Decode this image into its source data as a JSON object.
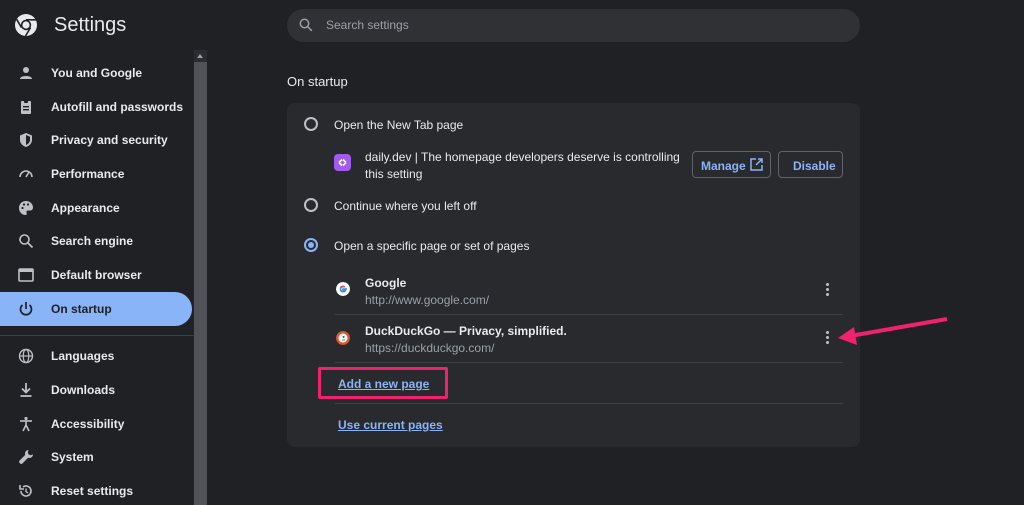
{
  "header": {
    "title": "Settings",
    "search_placeholder": "Search settings"
  },
  "sidebar": {
    "items": [
      {
        "label": "You and Google",
        "icon": "person-icon"
      },
      {
        "label": "Autofill and passwords",
        "icon": "clipboard-icon"
      },
      {
        "label": "Privacy and security",
        "icon": "shield-icon"
      },
      {
        "label": "Performance",
        "icon": "gauge-icon"
      },
      {
        "label": "Appearance",
        "icon": "palette-icon"
      },
      {
        "label": "Search engine",
        "icon": "search-icon"
      },
      {
        "label": "Default browser",
        "icon": "browser-icon"
      },
      {
        "label": "On startup",
        "icon": "power-icon",
        "active": true
      },
      {
        "label": "Languages",
        "icon": "globe-icon"
      },
      {
        "label": "Downloads",
        "icon": "download-icon"
      },
      {
        "label": "Accessibility",
        "icon": "accessibility-icon"
      },
      {
        "label": "System",
        "icon": "wrench-icon"
      },
      {
        "label": "Reset settings",
        "icon": "reset-icon"
      }
    ]
  },
  "main": {
    "section_title": "On startup",
    "options": [
      {
        "label": "Open the New Tab page",
        "selected": false
      },
      {
        "label": "Continue where you left off",
        "selected": false
      },
      {
        "label": "Open a specific page or set of pages",
        "selected": true
      }
    ],
    "extension": {
      "text": "daily.dev | The homepage developers deserve is controlling this setting",
      "manage_label": "Manage",
      "disable_label": "Disable"
    },
    "pages": [
      {
        "title": "Google",
        "url": "http://www.google.com/",
        "icon": "google-favicon"
      },
      {
        "title": "DuckDuckGo — Privacy, simplified.",
        "url": "https://duckduckgo.com/",
        "icon": "duckduckgo-favicon"
      }
    ],
    "add_page_label": "Add a new page",
    "use_current_label": "Use current pages"
  },
  "colors": {
    "accent": "#8ab4f8",
    "background": "#202124",
    "card": "#292a2d",
    "annotation": "#f0226e"
  }
}
